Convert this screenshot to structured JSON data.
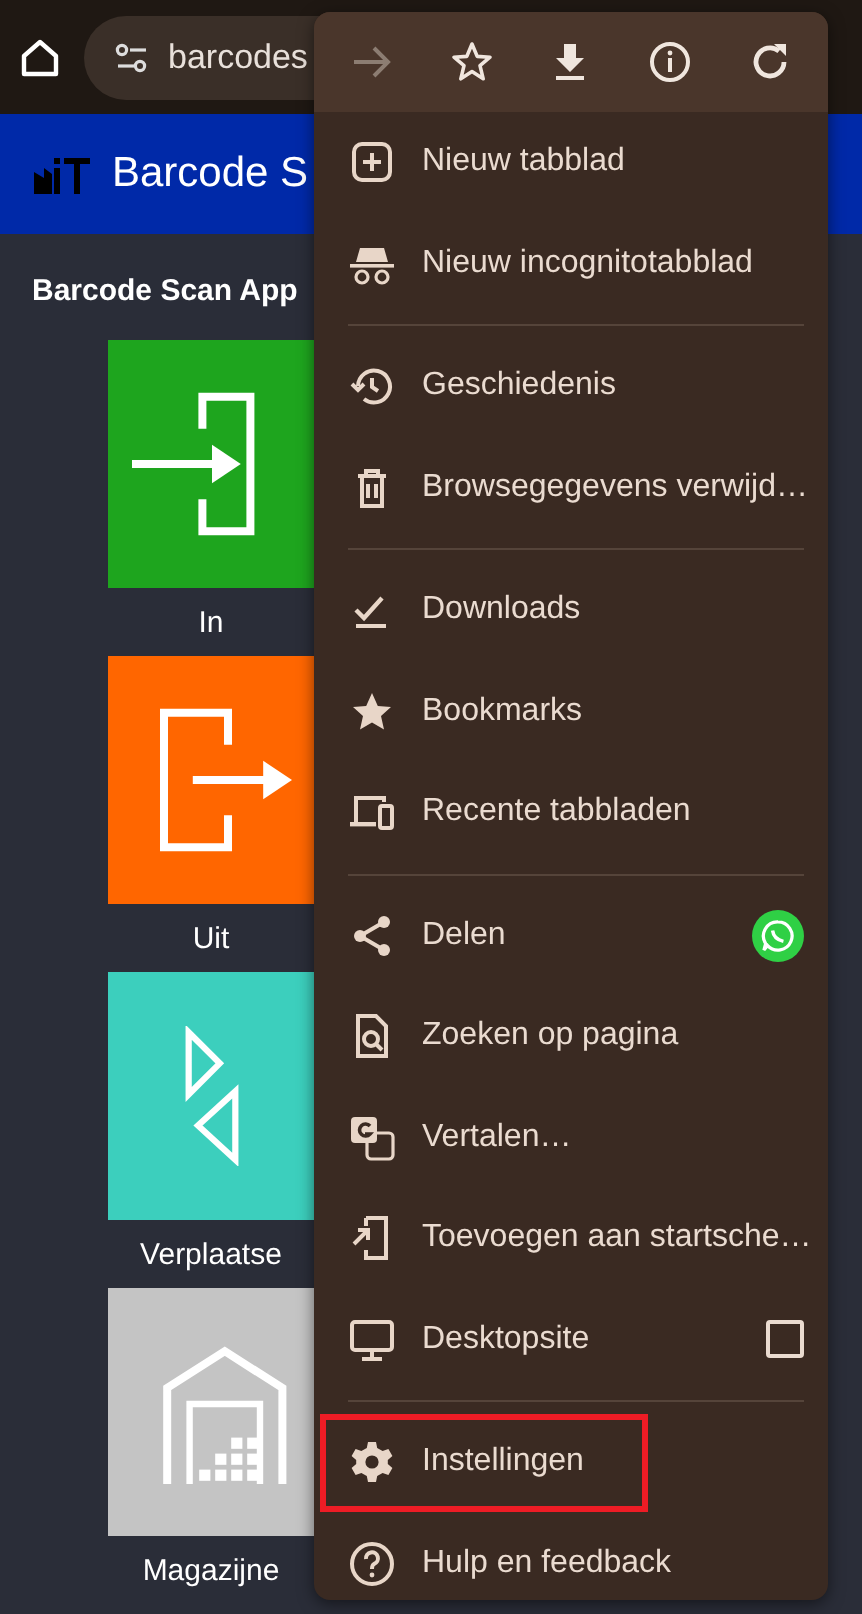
{
  "browser": {
    "url": "barcodes"
  },
  "page": {
    "header_title": "Barcode S",
    "app_title": "Barcode Scan App",
    "tiles": [
      {
        "kind": "in",
        "label": "In",
        "color": "#1ea51e"
      },
      {
        "kind": "out",
        "label": "Uit",
        "color": "#ff6600"
      },
      {
        "kind": "move",
        "label": "Verplaatse",
        "color": "#3ccfbd"
      },
      {
        "kind": "warehouse",
        "label": "Magazijne",
        "color": "#c4c4c4"
      }
    ]
  },
  "menu": {
    "toolbar": [
      {
        "kind": "forward",
        "disabled": true
      },
      {
        "kind": "star",
        "disabled": false
      },
      {
        "kind": "download",
        "disabled": false
      },
      {
        "kind": "info",
        "disabled": false
      },
      {
        "kind": "reload",
        "disabled": false
      }
    ],
    "groups": [
      [
        {
          "kind": "newtab",
          "label": "Nieuw tabblad"
        },
        {
          "kind": "incognito",
          "label": "Nieuw incognitotabblad"
        }
      ],
      [
        {
          "kind": "history",
          "label": "Geschiedenis"
        },
        {
          "kind": "trash",
          "label": "Browsegegevens verwijd…"
        }
      ],
      [
        {
          "kind": "downloads",
          "label": "Downloads"
        },
        {
          "kind": "bookmarks",
          "label": "Bookmarks"
        },
        {
          "kind": "recent",
          "label": "Recente tabbladen"
        }
      ],
      [
        {
          "kind": "share",
          "label": "Delen",
          "shortcut": true
        },
        {
          "kind": "find",
          "label": "Zoeken op pagina"
        },
        {
          "kind": "translate",
          "label": "Vertalen…"
        },
        {
          "kind": "addhome",
          "label": "Toevoegen aan startsche…"
        },
        {
          "kind": "desktop",
          "label": "Desktopsite",
          "checked": false
        }
      ],
      [
        {
          "kind": "settings",
          "label": "Instellingen",
          "highlighted": true
        },
        {
          "kind": "help",
          "label": "Hulp en feedback"
        }
      ]
    ]
  }
}
